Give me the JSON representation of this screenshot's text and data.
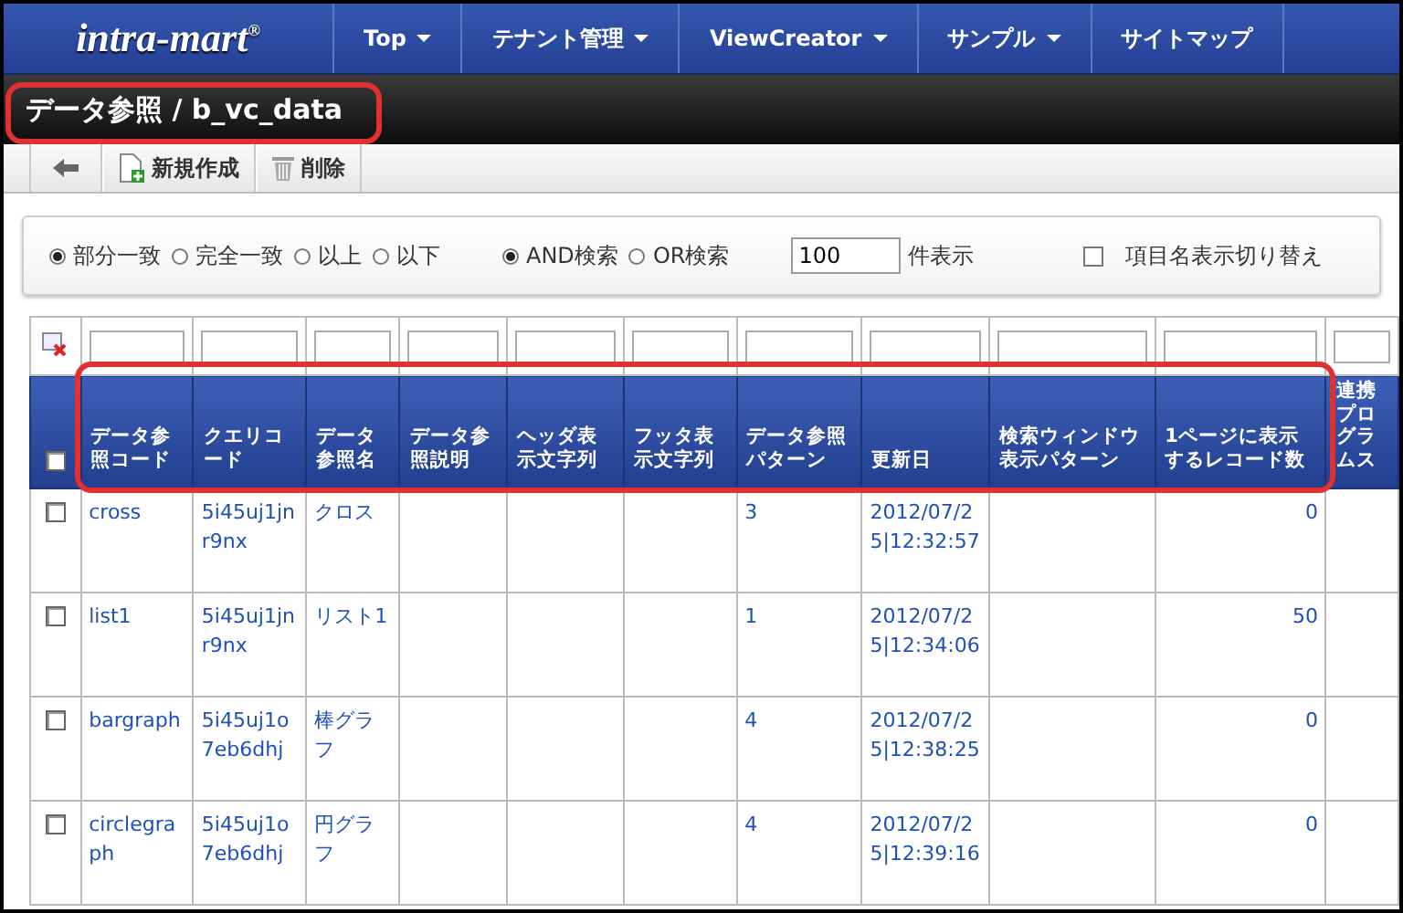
{
  "logo": {
    "text": "intra-mart",
    "mark": "®"
  },
  "nav": [
    {
      "label": "Top",
      "dropdown": true
    },
    {
      "label": "テナント管理",
      "dropdown": true
    },
    {
      "label": "ViewCreator",
      "dropdown": true
    },
    {
      "label": "サンプル",
      "dropdown": true
    },
    {
      "label": "サイトマップ",
      "dropdown": false
    }
  ],
  "title": "データ参照 / b_vc_data",
  "toolbar": [
    {
      "kind": "back"
    },
    {
      "kind": "new",
      "label": "新規作成"
    },
    {
      "kind": "delete",
      "label": "削除"
    }
  ],
  "search": {
    "match_options": [
      {
        "label": "部分一致",
        "selected": true
      },
      {
        "label": "完全一致",
        "selected": false
      },
      {
        "label": "以上",
        "selected": false
      },
      {
        "label": "以下",
        "selected": false
      }
    ],
    "logic_options": [
      {
        "label": "AND検索",
        "selected": true
      },
      {
        "label": "OR検索",
        "selected": false
      }
    ],
    "count_value": "100",
    "count_label": "件表示",
    "toggle": {
      "label": "項目名表示切り替え",
      "checked": false
    }
  },
  "table": {
    "all_checked": false,
    "columns": [
      {
        "label": "データ参照コード"
      },
      {
        "label": "クエリコード"
      },
      {
        "label": "データ参照名"
      },
      {
        "label": "データ参照説明"
      },
      {
        "label": "ヘッダ表示文字列"
      },
      {
        "label": "フッタ表示文字列"
      },
      {
        "label": "データ参照パターン"
      },
      {
        "label": "更新日"
      },
      {
        "label": "検索ウィンドウ表示パターン"
      },
      {
        "label": "1ページに表示するレコード数"
      },
      {
        "label": "連携プログラムス"
      }
    ],
    "rows": [
      {
        "checked": false,
        "code": "cross",
        "query": "5i45uj1jnr9nx",
        "name": "クロス",
        "pattern": "3",
        "updated": "2012/07/25|12:32:57",
        "records": "0"
      },
      {
        "checked": false,
        "code": "list1",
        "query": "5i45uj1jnr9nx",
        "name": "リスト1",
        "pattern": "1",
        "updated": "2012/07/25|12:34:06",
        "records": "50"
      },
      {
        "checked": false,
        "code": "bargraph",
        "query": "5i45uj1o7eb6dhj",
        "name": "棒グラフ",
        "pattern": "4",
        "updated": "2012/07/25|12:38:25",
        "records": "0"
      },
      {
        "checked": false,
        "code": "circlegraph",
        "query": "5i45uj1o7eb6dhj",
        "name": "円グラフ",
        "pattern": "4",
        "updated": "2012/07/25|12:39:16",
        "records": "0"
      }
    ]
  },
  "highlight": {
    "title": true,
    "table_header": true
  }
}
